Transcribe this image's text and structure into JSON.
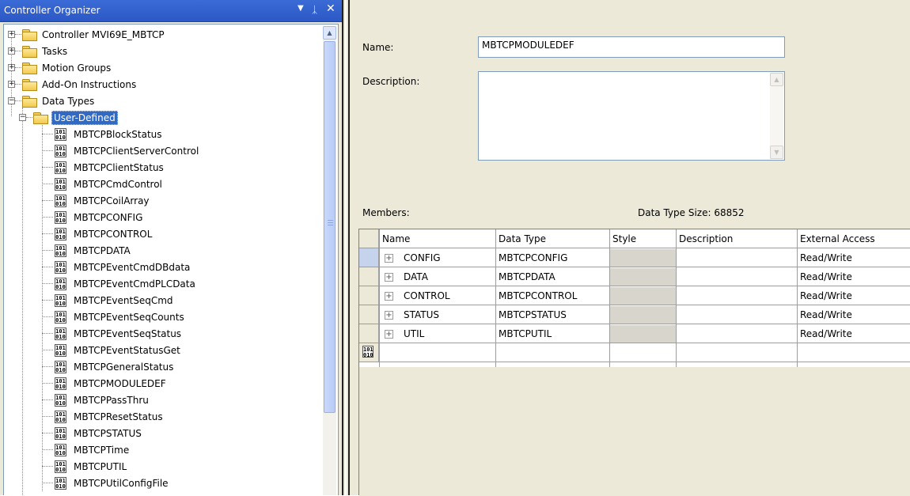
{
  "organizer": {
    "title": "Controller Organizer",
    "pin_icon": "pin-icon",
    "close_icon": "close-icon",
    "items": {
      "controller": "Controller MVI69E_MBTCP",
      "tasks": "Tasks",
      "motion": "Motion Groups",
      "aoi": "Add-On Instructions",
      "datatypes": "Data Types",
      "userdefined": "User-Defined"
    },
    "udts": [
      "MBTCPBlockStatus",
      "MBTCPClientServerControl",
      "MBTCPClientStatus",
      "MBTCPCmdControl",
      "MBTCPCoilArray",
      "MBTCPCONFIG",
      "MBTCPCONTROL",
      "MBTCPDATA",
      "MBTCPEventCmdDBdata",
      "MBTCPEventCmdPLCData",
      "MBTCPEventSeqCmd",
      "MBTCPEventSeqCounts",
      "MBTCPEventSeqStatus",
      "MBTCPEventStatusGet",
      "MBTCPGeneralStatus",
      "MBTCPMODULEDEF",
      "MBTCPPassThru",
      "MBTCPResetStatus",
      "MBTCPSTATUS",
      "MBTCPTime",
      "MBTCPUTIL",
      "MBTCPUtilConfigFile"
    ],
    "type_icon_text": "101\n010"
  },
  "editor": {
    "name_label": "Name:",
    "name_value": "MBTCPMODULEDEF",
    "description_label": "Description:",
    "description_value": "",
    "members_label": "Members:",
    "size_label": "Data Type Size: 68852",
    "columns": [
      "Name",
      "Data Type",
      "Style",
      "Description",
      "External Access"
    ],
    "members": [
      {
        "name": "CONFIG",
        "type": "MBTCPCONFIG",
        "style": "",
        "description": "",
        "access": "Read/Write"
      },
      {
        "name": "DATA",
        "type": "MBTCPDATA",
        "style": "",
        "description": "",
        "access": "Read/Write"
      },
      {
        "name": "CONTROL",
        "type": "MBTCPCONTROL",
        "style": "",
        "description": "",
        "access": "Read/Write"
      },
      {
        "name": "STATUS",
        "type": "MBTCPSTATUS",
        "style": "",
        "description": "",
        "access": "Read/Write"
      },
      {
        "name": "UTIL",
        "type": "MBTCPUTIL",
        "style": "",
        "description": "",
        "access": "Read/Write"
      }
    ]
  },
  "colors": {
    "title_bar": "#2b58c4",
    "selection": "#316ac5",
    "panel_bg": "#ece9d8"
  }
}
